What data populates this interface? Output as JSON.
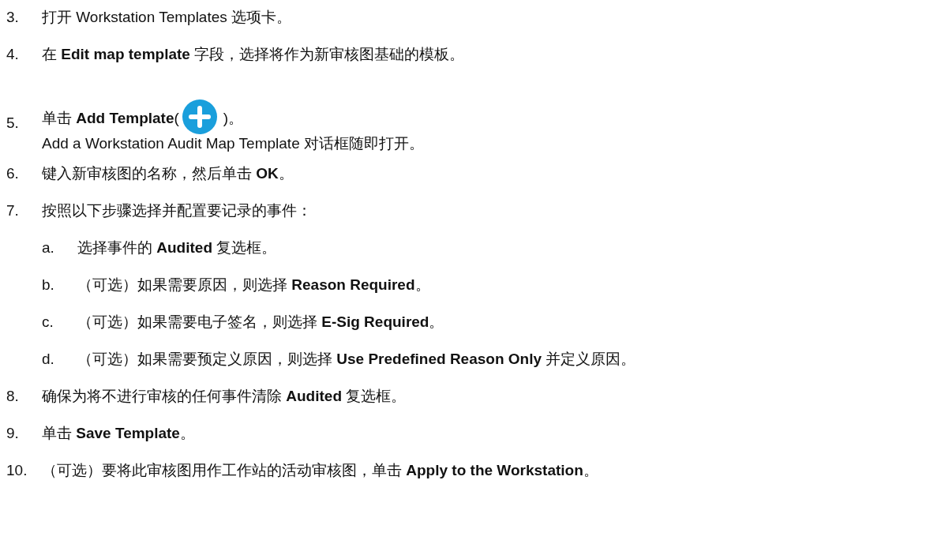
{
  "steps": [
    {
      "kind": "text",
      "number": "3.",
      "text": "打开 Workstation Templates 选项卡。"
    },
    {
      "kind": "text",
      "number": "4.",
      "text": "在 **Edit map template** 字段，选择将作为新审核图基础的模板。"
    },
    {
      "kind": "icon",
      "number": "5.",
      "text": "单击 **Add Template**(",
      "text_after": ")。",
      "note": "Add a Workstation Audit Map Template 对话框随即打开。"
    },
    {
      "kind": "text",
      "number": "6.",
      "text": "键入新审核图的名称，然后单击 **OK**。"
    },
    {
      "kind": "text",
      "number": "7.",
      "text": "按照以下步骤选择并配置要记录的事件：",
      "children": [
        {
          "number": "a.",
          "text": "选择事件的 **Audited** 复选框。"
        },
        {
          "number": "b.",
          "text": "（可选）如果需要原因，则选择 **Reason Required**。"
        },
        {
          "number": "c.",
          "text": "（可选）如果需要电子签名，则选择 **E-Sig Required**。"
        },
        {
          "number": "d.",
          "text": "（可选）如果需要预定义原因，则选择 **Use Predefined Reason Only** 并定义原因。"
        }
      ]
    },
    {
      "kind": "text",
      "number": "8.",
      "text": "确保为将不进行审核的任何事件清除 **Audited** 复选框。"
    },
    {
      "kind": "text",
      "number": "9.",
      "text": "单击 **Save Template**。"
    },
    {
      "kind": "text",
      "number": "10.",
      "text": "（可选）要将此审核图用作工作站的活动审核图，单击 **Apply to the Workstation**。"
    }
  ]
}
